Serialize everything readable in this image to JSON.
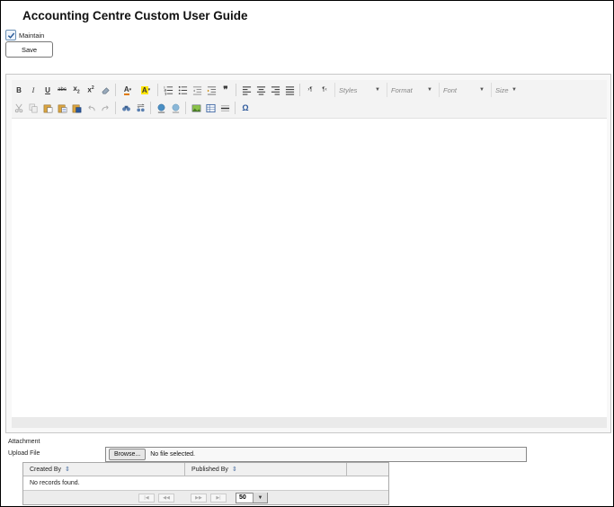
{
  "page": {
    "title": "Accounting Centre Custom User Guide"
  },
  "maintain": {
    "label": "Maintain",
    "checked": true
  },
  "actions": {
    "save_label": "Save"
  },
  "editor": {
    "toolbar_row1": [
      {
        "name": "bold-icon",
        "glyph": "B"
      },
      {
        "name": "italic-icon",
        "glyph": "I"
      },
      {
        "name": "underline-icon",
        "glyph": "U"
      },
      {
        "name": "strikethrough-icon",
        "glyph": "abc"
      },
      {
        "name": "subscript-icon",
        "glyph": "x₂"
      },
      {
        "name": "superscript-icon",
        "glyph": "x²"
      },
      {
        "name": "remove-format-icon",
        "glyph": "eraser"
      },
      {
        "name": "text-color-icon",
        "glyph": "A"
      },
      {
        "name": "background-color-icon",
        "glyph": "A"
      },
      {
        "name": "numbered-list-icon",
        "glyph": "ol"
      },
      {
        "name": "bulleted-list-icon",
        "glyph": "ul"
      },
      {
        "name": "decrease-indent-icon",
        "glyph": "outdent"
      },
      {
        "name": "increase-indent-icon",
        "glyph": "indent"
      },
      {
        "name": "blockquote-icon",
        "glyph": "❞"
      },
      {
        "name": "align-left-icon",
        "glyph": "left"
      },
      {
        "name": "align-center-icon",
        "glyph": "center"
      },
      {
        "name": "align-right-icon",
        "glyph": "right"
      },
      {
        "name": "justify-icon",
        "glyph": "justify"
      },
      {
        "name": "text-direction-ltr-icon",
        "glyph": "¶"
      },
      {
        "name": "text-direction-rtl-icon",
        "glyph": "¶"
      }
    ],
    "combos": {
      "styles": "Styles",
      "format": "Format",
      "font": "Font",
      "size": "Size"
    },
    "toolbar_row2": [
      {
        "name": "cut-icon"
      },
      {
        "name": "copy-icon"
      },
      {
        "name": "paste-icon"
      },
      {
        "name": "paste-text-icon"
      },
      {
        "name": "paste-word-icon"
      },
      {
        "name": "undo-icon"
      },
      {
        "name": "redo-icon"
      },
      {
        "name": "find-icon"
      },
      {
        "name": "replace-icon"
      },
      {
        "name": "link-icon"
      },
      {
        "name": "unlink-icon"
      },
      {
        "name": "image-icon"
      },
      {
        "name": "table-icon"
      },
      {
        "name": "horizontal-rule-icon"
      },
      {
        "name": "special-character-icon"
      }
    ]
  },
  "attachment": {
    "heading": "Attachment",
    "upload_label": "Upload File",
    "browse_label": "Browse...",
    "file_status": "No file selected."
  },
  "grid": {
    "columns": [
      "Created By",
      "Published By",
      ""
    ],
    "empty_message": "No records found.",
    "page_size": "50"
  },
  "colors": {
    "accent": "#4a6fa0",
    "toolbar_bg": "#f3f3f3",
    "editor_border": "#c8c8c8"
  }
}
